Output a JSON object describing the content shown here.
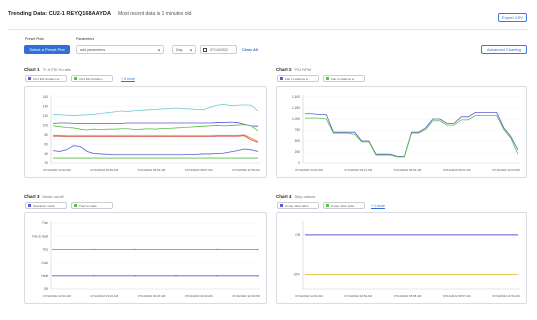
{
  "header": {
    "title": "Trending Data: CU2-1 REYQ168AAYDA",
    "subtitle": "Most recent data is 1 minutes old",
    "export_label": "Export CSV"
  },
  "toolbar": {
    "preset_heading": "Preset Plots",
    "preset_button": "Select a Preset Plot",
    "params_heading": "Parameters",
    "params_placeholder": "add parameters",
    "range_value": "Day",
    "date_value": "07/14/2022",
    "clear_label": "Clear All",
    "advanced_label": "Advanced Charting"
  },
  "colors": {
    "accent": "#2f6fd6",
    "purple": "#5b5bd6",
    "green": "#5bbf4a",
    "cyan": "#76c7dc",
    "orange": "#e8832a",
    "red": "#d9534f",
    "yellow": "#e8c13a"
  },
  "charts": [
    {
      "title": "Chart 1",
      "units": "°F  A  PSI  % ratio",
      "chips": [
        "CU1 kW Outdoor te...",
        "CU2 kW Outdoor..."
      ],
      "more_link": "+ 5 more"
    },
    {
      "title": "Chart 2",
      "units": "PSI  RPM",
      "chips": [
        "Fan 1 rotations a...",
        "Fan 2 rotations a..."
      ],
      "more_link": ""
    },
    {
      "title": "Chart 3",
      "units": "Mode  on/off",
      "chips": [
        "Operation mode",
        "Thermo state"
      ],
      "more_link": ""
    },
    {
      "title": "Chart 4",
      "units": "Step values",
      "chips": [
        "Unrep valve HP/L...",
        "Unrep valve subc..."
      ],
      "more_link": "+ 1 more"
    }
  ],
  "chart_data": [
    {
      "type": "line",
      "yticks": [
        "160",
        "140",
        "120",
        "100",
        "80",
        "60",
        "40",
        "20"
      ],
      "xticks": [
        "07/14/2022 12:00 AM",
        "07/14/2022 02:59 AM",
        "07/14/2022 05:59 AM",
        "07/14/2022 08:57 AM",
        "07/14/2022 11:56 AM"
      ],
      "ylim": [
        10,
        170
      ],
      "series": [
        {
          "color": "cyan",
          "values": [
            128,
            127,
            126,
            125,
            126,
            127,
            128,
            130,
            132,
            134,
            136,
            135,
            137,
            138,
            139,
            140,
            141,
            142,
            143,
            142,
            141,
            140,
            139,
            145,
            150,
            152,
            149,
            150,
            151,
            150,
            136
          ]
        },
        {
          "color": "purple",
          "values": [
            106,
            107,
            107,
            106,
            106,
            106,
            106,
            106,
            106,
            106,
            106,
            107,
            107,
            107,
            107,
            107,
            107,
            107,
            107,
            107,
            107,
            107,
            107,
            107,
            108,
            108,
            109,
            108,
            104,
            100,
            99
          ]
        },
        {
          "color": "green",
          "values": [
            100,
            98,
            96,
            95,
            92,
            90,
            92,
            91,
            92,
            92,
            93,
            93,
            91,
            92,
            93,
            92,
            94,
            94,
            95,
            96,
            97,
            98,
            99,
            100,
            101,
            100,
            101,
            102,
            103,
            100,
            88
          ]
        },
        {
          "color": "orange",
          "values": [
            77,
            77,
            76,
            76,
            76,
            76,
            76,
            76,
            76,
            76,
            76,
            76,
            76,
            76,
            76,
            76,
            76,
            76,
            76,
            76,
            76,
            76,
            76,
            76,
            77,
            77,
            77,
            77,
            78,
            70,
            62
          ]
        },
        {
          "color": "red",
          "values": [
            75,
            75,
            74,
            74,
            74,
            74,
            74,
            74,
            74,
            74,
            74,
            74,
            74,
            74,
            74,
            74,
            74,
            74,
            74,
            74,
            74,
            74,
            74,
            74,
            75,
            75,
            75,
            75,
            76,
            66,
            60
          ]
        },
        {
          "color": "purple",
          "values": [
            40,
            38,
            42,
            52,
            50,
            38,
            33,
            32,
            31,
            30,
            30,
            30,
            30,
            30,
            30,
            30,
            30,
            30,
            30,
            30,
            31,
            31,
            32,
            32,
            33,
            34,
            37,
            40,
            44,
            42,
            38
          ]
        },
        {
          "color": "green",
          "values": [
            22,
            22,
            22,
            22,
            22,
            22,
            22,
            22,
            22,
            22,
            22,
            22,
            22,
            22,
            22,
            22,
            22,
            22,
            22,
            22,
            22,
            22,
            22,
            22,
            22,
            22,
            22,
            22,
            22,
            22,
            22
          ]
        }
      ]
    },
    {
      "type": "line",
      "yticks": [
        "1,500",
        "1,250",
        "1,000",
        "750",
        "500",
        "250",
        "0"
      ],
      "xticks": [
        "07/14/2022 12:00 AM",
        "07/14/2022 03:01 AM",
        "07/14/2022 06:02 AM",
        "07/14/2022 09:01 AM",
        "07/14/2022 12:04 PM"
      ],
      "ylim": [
        0,
        1500
      ],
      "series": [
        {
          "color": "purple",
          "values": [
            1120,
            1120,
            1100,
            1100,
            700,
            700,
            700,
            700,
            500,
            500,
            200,
            200,
            200,
            150,
            150,
            700,
            700,
            800,
            1000,
            1000,
            900,
            900,
            1050,
            1050,
            1150,
            1150,
            1150,
            1150,
            800,
            600,
            300
          ]
        },
        {
          "color": "green",
          "values": [
            1020,
            1020,
            1020,
            1000,
            680,
            680,
            680,
            650,
            480,
            480,
            180,
            180,
            180,
            140,
            140,
            680,
            680,
            760,
            960,
            960,
            860,
            860,
            980,
            980,
            1080,
            1080,
            1080,
            1080,
            760,
            560,
            200
          ]
        }
      ]
    },
    {
      "type": "line",
      "yticks": [
        "Fan",
        "Fan & heat",
        "Dry",
        "Cool",
        "Heat",
        "Off"
      ],
      "xticks": [
        "07/14/2022 12:00 AM",
        "07/14/2022 03:10 AM",
        "07/14/2022 06:20 AM",
        "07/14/2022 09:30 AM",
        "07/14/2022 12:40 PM"
      ],
      "series": [
        {
          "color": "green",
          "level": 3
        },
        {
          "color": "purple",
          "level": 1
        }
      ]
    },
    {
      "type": "line",
      "yticks": [
        "ON",
        "OFF"
      ],
      "xticks": [
        "07/14/2022 12:00 AM",
        "07/14/2022 02:59 AM",
        "07/14/2022 05:58 AM",
        "07/14/2022 08:57 AM",
        "07/14/2022 11:56 AM"
      ],
      "series": [
        {
          "color": "purple",
          "level": 1
        },
        {
          "color": "yellow",
          "level": 0
        }
      ]
    }
  ]
}
